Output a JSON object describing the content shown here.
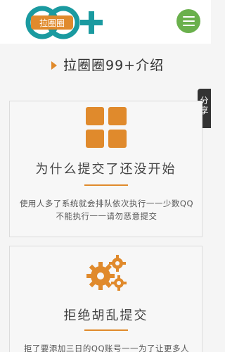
{
  "header": {
    "logo_text": "拉圈圈",
    "logo_mark": "99+"
  },
  "section": {
    "title": "拉圈圈99+介绍"
  },
  "share": {
    "label_1": "分",
    "label_2": "享"
  },
  "cards": [
    {
      "icon": "grid-icon",
      "title": "为什么提交了还没开始",
      "desc": "使用人多了系统就会排队依次执行一一少数QQ不能执行一一请勿恶意提交"
    },
    {
      "icon": "gears-icon",
      "title": "拒绝胡乱提交",
      "desc": "拒了要添加三日的QQ账号一一为了让更多人"
    }
  ],
  "colors": {
    "accent": "#e08a2c",
    "menu": "#6ab04c",
    "logo_teal": "#1a9aa0"
  }
}
